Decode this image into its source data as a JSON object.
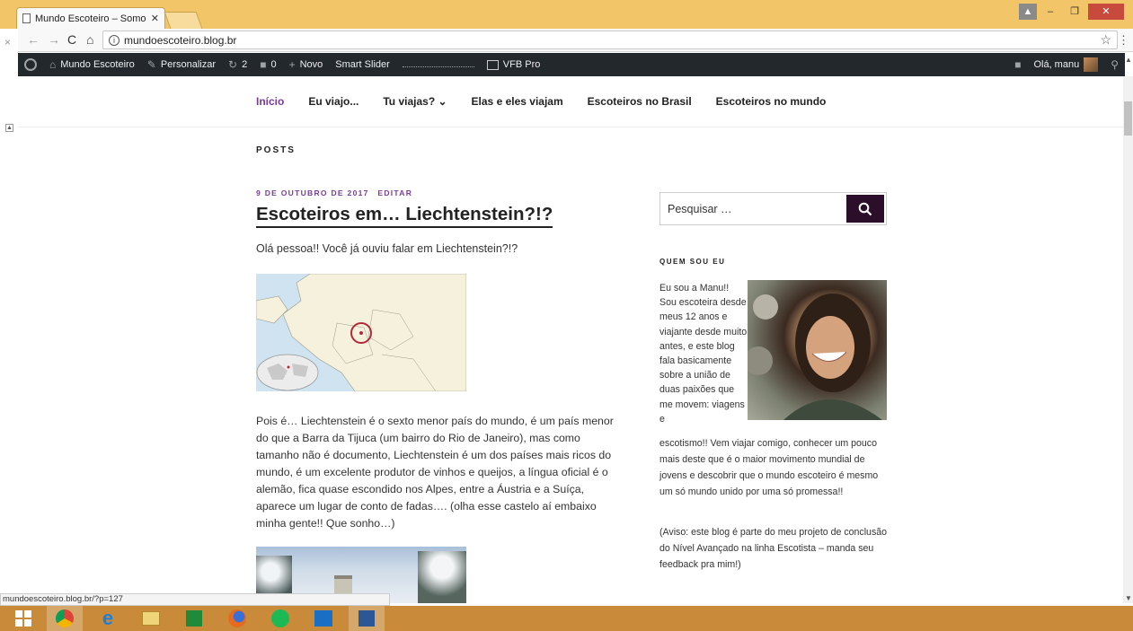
{
  "browser": {
    "tab_title": "Mundo Escoteiro – Somo",
    "url": "mundoescoteiro.blog.br",
    "status_url": "mundoescoteiro.blog.br/?p=127"
  },
  "adminbar": {
    "site_name": "Mundo Escoteiro",
    "customize": "Personalizar",
    "updates_count": "2",
    "comments_count": "0",
    "new": "Novo",
    "smart_slider": "Smart Slider",
    "vfb": "VFB Pro",
    "greeting": "Olá, manu"
  },
  "nav": {
    "items": [
      {
        "label": "Início",
        "active": true
      },
      {
        "label": "Eu viajo..."
      },
      {
        "label": "Tu viajas? ⌄"
      },
      {
        "label": "Elas e eles viajam"
      },
      {
        "label": "Escoteiros no Brasil"
      },
      {
        "label": "Escoteiros no mundo"
      }
    ]
  },
  "content": {
    "section_heading": "POSTS",
    "post": {
      "date": "9 DE OUTUBRO DE 2017",
      "edit": "EDITAR",
      "title": "Escoteiros em… Liechtenstein?!?",
      "intro": "Olá pessoa!! Você já ouviu falar em Liechtenstein?!?",
      "body": "Pois é… Liechtenstein é o sexto menor país do mundo, é um país menor do que a Barra da Tijuca (um bairro do Rio de Janeiro), mas como tamanho não é documento, Liechtenstein é um dos países mais ricos do mundo, é um excelente produtor de vinhos e queijos,  a língua oficial é o alemão, fica quase escondido nos Alpes, entre a Áustria e a Suíça, aparece um lugar de conto de fadas…. (olha esse castelo aí embaixo minha gente!! Que sonho…)"
    }
  },
  "sidebar": {
    "search_placeholder": "Pesquisar …",
    "widget_title": "QUEM SOU EU",
    "about_part1": "Eu sou a Manu!! Sou escoteira desde meus 12 anos e viajante desde muito antes, e este blog fala basicamente sobre a união de duas paixões que me movem: viagens e",
    "about_part2": "escotismo!! Vem viajar comigo, conhecer um pouco mais deste que é o maior movimento mundial de jovens e descobrir que o mundo escoteiro é mesmo um só mundo unido por uma só promessa!!",
    "about_note": "(Aviso: este blog é parte do meu projeto de conclusão do Nível Avançado na linha Escotista – manda seu feedback pra mim!)"
  },
  "colors": {
    "accent": "#7a3a9a",
    "adminbar": "#23282d",
    "search_button": "#2b0f2a",
    "titlebar": "#f2c568",
    "taskbar": "#c98a3a"
  }
}
